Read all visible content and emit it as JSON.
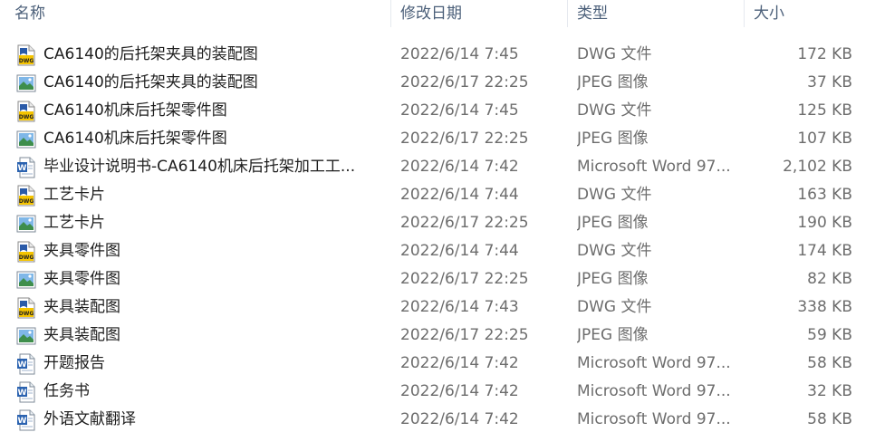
{
  "columns": {
    "name": "名称",
    "date": "修改日期",
    "type": "类型",
    "size": "大小"
  },
  "files": [
    {
      "name": "CA6140的后托架夹具的装配图",
      "date": "2022/6/14 7:45",
      "type": "DWG 文件",
      "size": "172 KB",
      "icon": "dwg-file-icon"
    },
    {
      "name": "CA6140的后托架夹具的装配图",
      "date": "2022/6/17 22:25",
      "type": "JPEG 图像",
      "size": "37 KB",
      "icon": "jpeg-image-icon"
    },
    {
      "name": "CA6140机床后托架零件图",
      "date": "2022/6/14 7:45",
      "type": "DWG 文件",
      "size": "125 KB",
      "icon": "dwg-file-icon"
    },
    {
      "name": "CA6140机床后托架零件图",
      "date": "2022/6/17 22:25",
      "type": "JPEG 图像",
      "size": "107 KB",
      "icon": "jpeg-image-icon"
    },
    {
      "name": "毕业设计说明书-CA6140机床后托架加工工...",
      "date": "2022/6/14 7:42",
      "type": "Microsoft Word 97...",
      "size": "2,102 KB",
      "icon": "word-document-icon"
    },
    {
      "name": "工艺卡片",
      "date": "2022/6/14 7:44",
      "type": "DWG 文件",
      "size": "163 KB",
      "icon": "dwg-file-icon"
    },
    {
      "name": "工艺卡片",
      "date": "2022/6/17 22:25",
      "type": "JPEG 图像",
      "size": "190 KB",
      "icon": "jpeg-image-icon"
    },
    {
      "name": "夹具零件图",
      "date": "2022/6/14 7:44",
      "type": "DWG 文件",
      "size": "174 KB",
      "icon": "dwg-file-icon"
    },
    {
      "name": "夹具零件图",
      "date": "2022/6/17 22:25",
      "type": "JPEG 图像",
      "size": "82 KB",
      "icon": "jpeg-image-icon"
    },
    {
      "name": "夹具装配图",
      "date": "2022/6/14 7:43",
      "type": "DWG 文件",
      "size": "338 KB",
      "icon": "dwg-file-icon"
    },
    {
      "name": "夹具装配图",
      "date": "2022/6/17 22:25",
      "type": "JPEG 图像",
      "size": "59 KB",
      "icon": "jpeg-image-icon"
    },
    {
      "name": "开题报告",
      "date": "2022/6/14 7:42",
      "type": "Microsoft Word 97...",
      "size": "58 KB",
      "icon": "word-document-icon"
    },
    {
      "name": "任务书",
      "date": "2022/6/14 7:42",
      "type": "Microsoft Word 97...",
      "size": "32 KB",
      "icon": "word-document-icon"
    },
    {
      "name": "外语文献翻译",
      "date": "2022/6/14 7:42",
      "type": "Microsoft Word 97...",
      "size": "58 KB",
      "icon": "word-document-icon"
    }
  ]
}
